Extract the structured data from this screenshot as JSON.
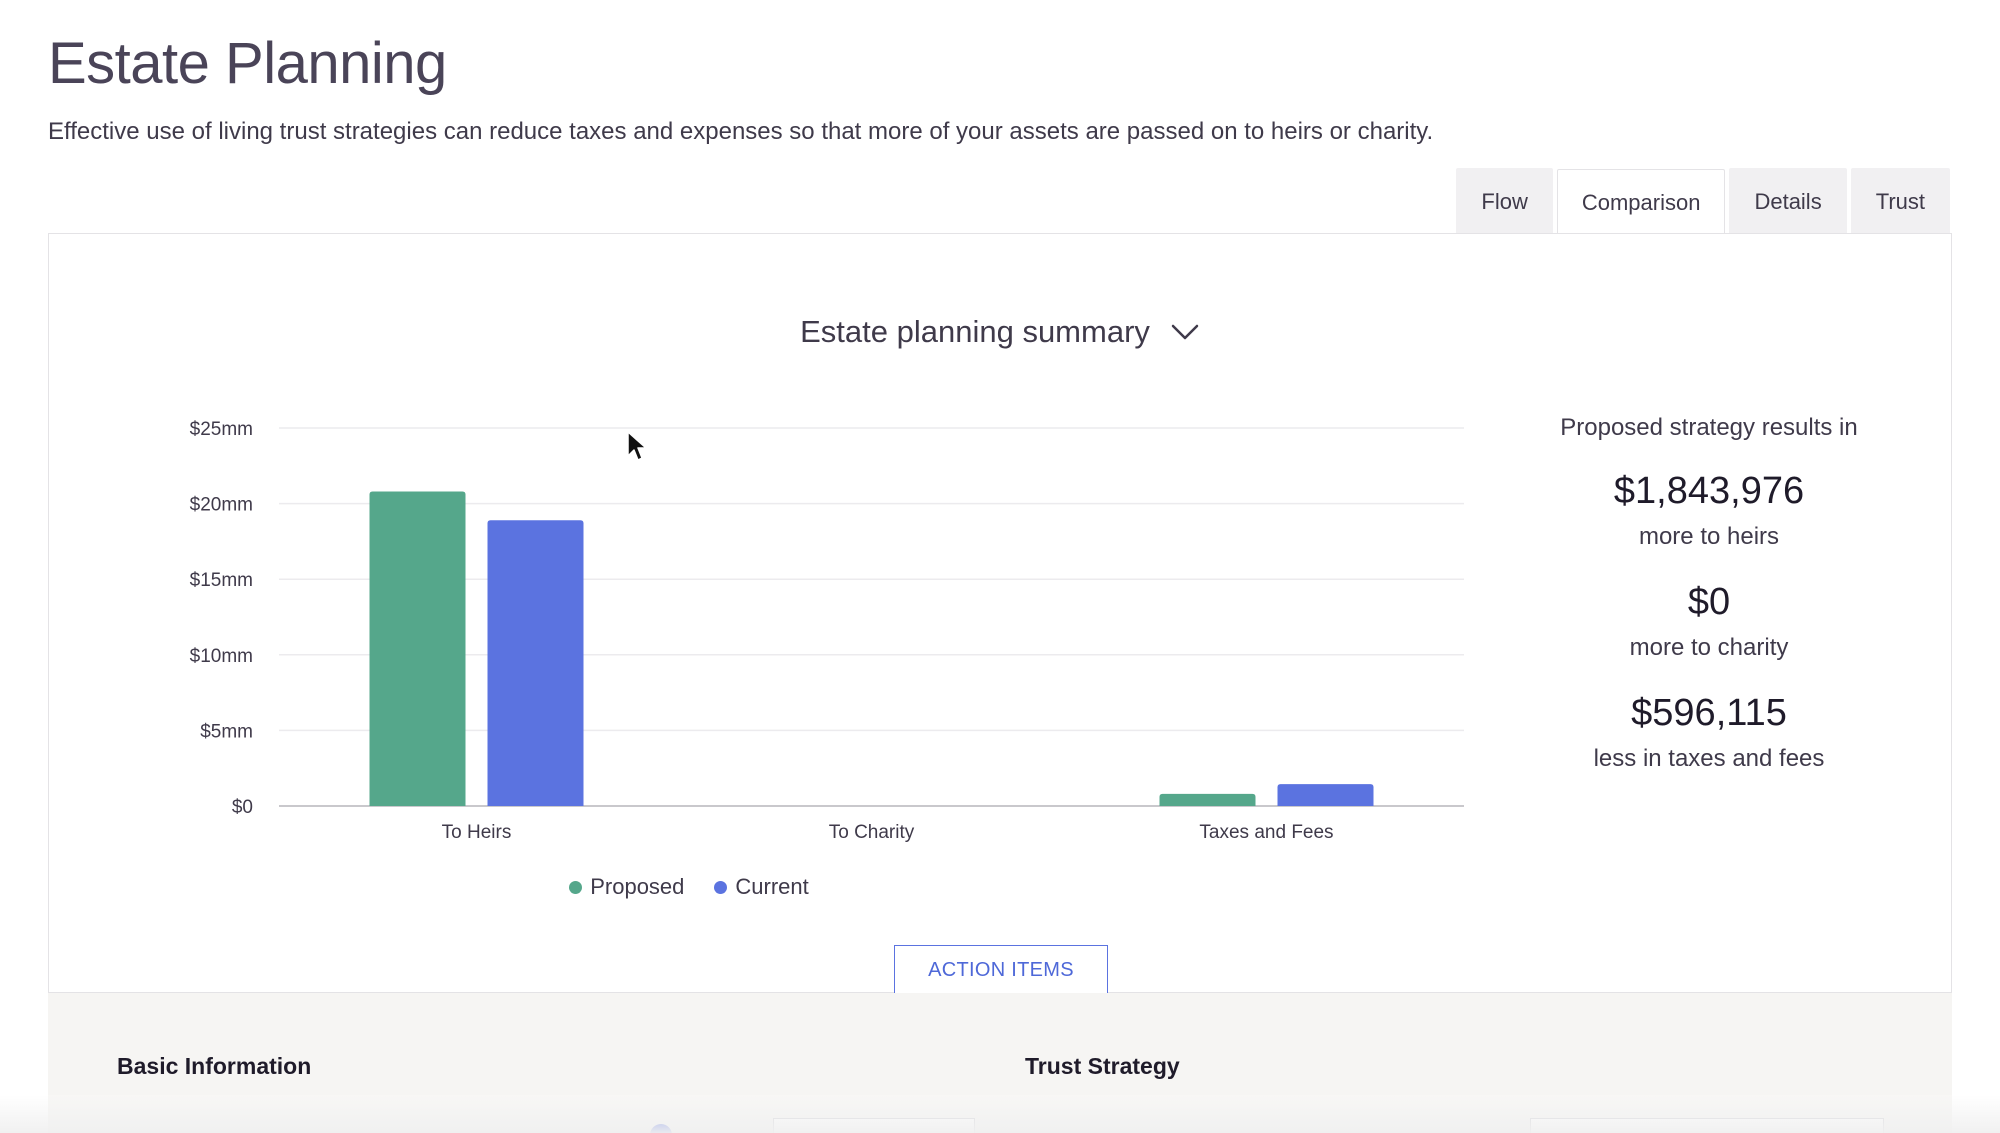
{
  "page": {
    "title": "Estate Planning",
    "subtitle": "Effective use of living trust strategies can reduce taxes and expenses so that more of your assets are passed on to heirs or charity."
  },
  "tabs": [
    {
      "label": "Flow",
      "active": false
    },
    {
      "label": "Comparison",
      "active": true
    },
    {
      "label": "Details",
      "active": false
    },
    {
      "label": "Trust",
      "active": false
    }
  ],
  "summary_select": {
    "label": "Estate planning summary"
  },
  "chart_data": {
    "type": "bar",
    "categories": [
      "To Heirs",
      "To Charity",
      "Taxes and Fees"
    ],
    "series": [
      {
        "name": "Proposed",
        "color": "#55a78b",
        "values": [
          20.8,
          0,
          0.8
        ]
      },
      {
        "name": "Current",
        "color": "#5b73e0",
        "values": [
          18.9,
          0,
          1.45
        ]
      }
    ],
    "y_ticks": [
      "$0",
      "$5mm",
      "$10mm",
      "$15mm",
      "$20mm",
      "$25mm"
    ],
    "ylim": [
      0,
      25
    ],
    "grid": true,
    "legend": "bottom-center"
  },
  "stats": {
    "intro": "Proposed strategy results in",
    "items": [
      {
        "value": "$1,843,976",
        "label": "more to heirs"
      },
      {
        "value": "$0",
        "label": "more to charity"
      },
      {
        "value": "$596,115",
        "label": "less in taxes and fees"
      }
    ]
  },
  "action_button": {
    "label": "ACTION ITEMS"
  },
  "bottom": {
    "basic_heading": "Basic Information",
    "trust_heading": "Trust Strategy"
  },
  "icons": {
    "dropdown": "chevron-down-icon",
    "cursor": "mouse-pointer-icon"
  }
}
